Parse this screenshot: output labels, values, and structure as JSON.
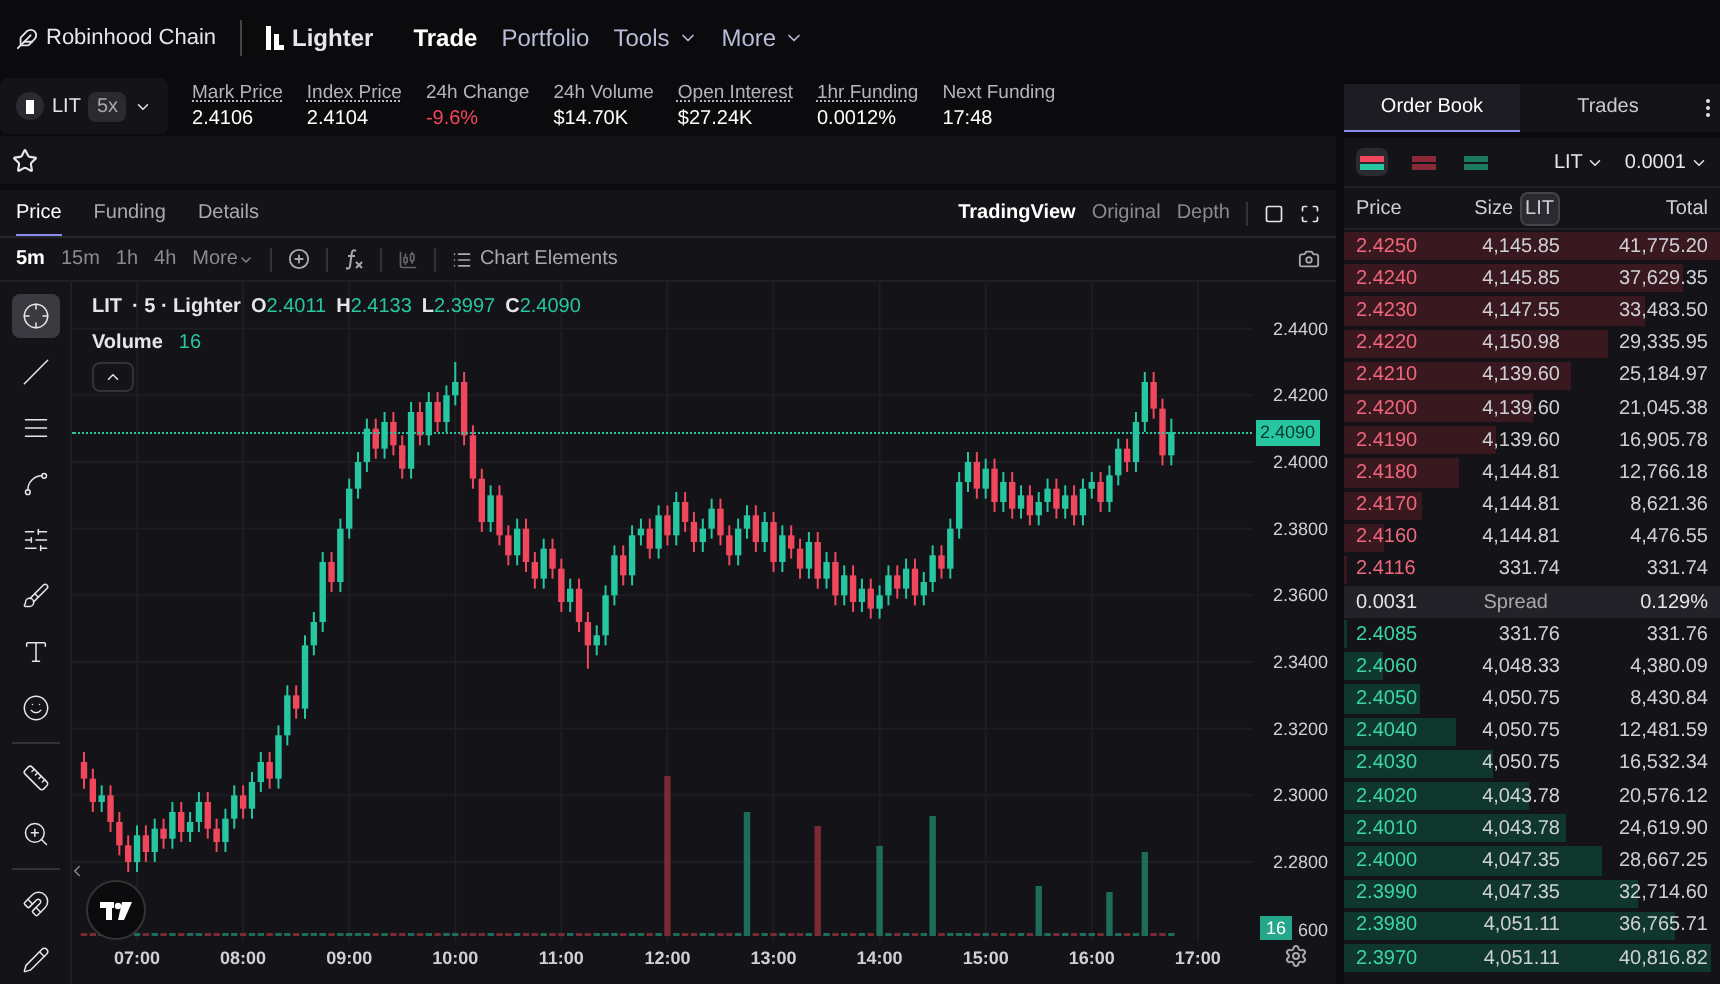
{
  "nav": {
    "brand": "Robinhood Chain",
    "logo": "Lighter",
    "items": [
      {
        "label": "Trade",
        "selected": true,
        "menu": false
      },
      {
        "label": "Portfolio",
        "selected": false,
        "menu": false
      },
      {
        "label": "Tools",
        "selected": false,
        "menu": true
      },
      {
        "label": "More",
        "selected": false,
        "menu": true
      }
    ]
  },
  "market": {
    "symbol": "LIT",
    "leverage": "5x",
    "stats": [
      {
        "label": "Mark Price",
        "value": "2.4106",
        "underlined": true,
        "negative": false
      },
      {
        "label": "Index Price",
        "value": "2.4104",
        "underlined": true,
        "negative": false
      },
      {
        "label": "24h Change",
        "value": "-9.6%",
        "underlined": false,
        "negative": true
      },
      {
        "label": "24h Volume",
        "value": "$14.70K",
        "underlined": false,
        "negative": false
      },
      {
        "label": "Open Interest",
        "value": "$27.24K",
        "underlined": true,
        "negative": false
      },
      {
        "label": "1hr Funding",
        "value": "0.0012%",
        "underlined": true,
        "negative": false
      },
      {
        "label": "Next Funding",
        "value": "17:48",
        "underlined": false,
        "negative": false
      }
    ]
  },
  "chart_tabs": [
    {
      "label": "Price",
      "selected": true
    },
    {
      "label": "Funding",
      "selected": false
    },
    {
      "label": "Details",
      "selected": false
    }
  ],
  "chart_views": [
    {
      "label": "TradingView",
      "selected": true
    },
    {
      "label": "Original",
      "selected": false
    },
    {
      "label": "Depth",
      "selected": false
    }
  ],
  "intervals": [
    {
      "label": "5m",
      "selected": true
    },
    {
      "label": "15m",
      "selected": false
    },
    {
      "label": "1h",
      "selected": false
    },
    {
      "label": "4h",
      "selected": false
    }
  ],
  "more_label": "More",
  "chart_elements": "Chart Elements",
  "legend": {
    "title": "LIT",
    "detail": "· 5 · Lighter",
    "ohlc": [
      {
        "key": "O",
        "value": "2.4011"
      },
      {
        "key": "H",
        "value": "2.4133"
      },
      {
        "key": "L",
        "value": "2.3997"
      },
      {
        "key": "C",
        "value": "2.4090"
      }
    ],
    "volume_label": "Volume",
    "volume_value": "16"
  },
  "chart": {
    "chart_data": {
      "type": "candlestick",
      "ylim": [
        2.256,
        2.454
      ],
      "categories": [
        null,
        null,
        null,
        null,
        null,
        null,
        "07:00",
        null,
        null,
        null,
        null,
        null,
        null,
        null,
        null,
        null,
        null,
        null,
        "08:00",
        null,
        null,
        null,
        null,
        null,
        null,
        null,
        null,
        null,
        null,
        null,
        "09:00",
        null,
        null,
        null,
        null,
        null,
        null,
        null,
        null,
        null,
        null,
        null,
        "10:00",
        null,
        null,
        null,
        null,
        null,
        null,
        null,
        null,
        null,
        null,
        null,
        "11:00",
        null,
        null,
        null,
        null,
        null,
        null,
        null,
        null,
        null,
        null,
        null,
        "12:00",
        null,
        null,
        null,
        null,
        null,
        null,
        null,
        null,
        null,
        null,
        null,
        "13:00",
        null,
        null,
        null,
        null,
        null,
        null,
        null,
        null,
        null,
        null,
        null,
        "14:00",
        null,
        null,
        null,
        null,
        null,
        null,
        null,
        null,
        null,
        null,
        null,
        "15:00",
        null,
        null,
        null,
        null,
        null,
        null,
        null,
        null,
        null,
        null,
        null,
        "16:00",
        null,
        null,
        null,
        null,
        null,
        null,
        null,
        null,
        null,
        null,
        null,
        "17:00"
      ],
      "ohlc": [
        [
          2.31,
          2.313,
          2.302,
          2.305
        ],
        [
          2.305,
          2.308,
          2.295,
          2.298
        ],
        [
          2.298,
          2.303,
          2.295,
          2.3
        ],
        [
          2.3,
          2.303,
          2.289,
          2.292
        ],
        [
          2.292,
          2.295,
          2.282,
          2.285
        ],
        [
          2.285,
          2.288,
          2.277,
          2.28
        ],
        [
          2.28,
          2.291,
          2.277,
          2.288
        ],
        [
          2.288,
          2.291,
          2.28,
          2.283
        ],
        [
          2.283,
          2.293,
          2.28,
          2.29
        ],
        [
          2.29,
          2.293,
          2.284,
          2.287
        ],
        [
          2.287,
          2.298,
          2.284,
          2.295
        ],
        [
          2.295,
          2.298,
          2.286,
          2.289
        ],
        [
          2.289,
          2.295,
          2.286,
          2.292
        ],
        [
          2.292,
          2.301,
          2.289,
          2.298
        ],
        [
          2.298,
          2.301,
          2.287,
          2.29
        ],
        [
          2.29,
          2.293,
          2.283,
          2.286
        ],
        [
          2.286,
          2.296,
          2.283,
          2.293
        ],
        [
          2.293,
          2.303,
          2.29,
          2.3
        ],
        [
          2.3,
          2.303,
          2.293,
          2.296
        ],
        [
          2.296,
          2.307,
          2.293,
          2.304
        ],
        [
          2.304,
          2.313,
          2.301,
          2.31
        ],
        [
          2.31,
          2.313,
          2.302,
          2.305
        ],
        [
          2.305,
          2.321,
          2.302,
          2.318
        ],
        [
          2.318,
          2.333,
          2.315,
          2.33
        ],
        [
          2.33,
          2.333,
          2.323,
          2.326
        ],
        [
          2.326,
          2.348,
          2.323,
          2.345
        ],
        [
          2.345,
          2.355,
          2.342,
          2.352
        ],
        [
          2.352,
          2.373,
          2.349,
          2.37
        ],
        [
          2.37,
          2.373,
          2.361,
          2.364
        ],
        [
          2.364,
          2.383,
          2.361,
          2.38
        ],
        [
          2.38,
          2.395,
          2.377,
          2.392
        ],
        [
          2.392,
          2.403,
          2.389,
          2.4
        ],
        [
          2.4,
          2.413,
          2.397,
          2.41
        ],
        [
          2.41,
          2.413,
          2.401,
          2.404
        ],
        [
          2.404,
          2.415,
          2.401,
          2.412
        ],
        [
          2.412,
          2.415,
          2.402,
          2.405
        ],
        [
          2.405,
          2.408,
          2.395,
          2.398
        ],
        [
          2.398,
          2.418,
          2.395,
          2.415
        ],
        [
          2.415,
          2.418,
          2.405,
          2.408
        ],
        [
          2.408,
          2.421,
          2.405,
          2.418
        ],
        [
          2.418,
          2.421,
          2.409,
          2.412
        ],
        [
          2.412,
          2.423,
          2.409,
          2.42
        ],
        [
          2.42,
          2.43,
          2.417,
          2.424
        ],
        [
          2.424,
          2.427,
          2.405,
          2.408
        ],
        [
          2.408,
          2.411,
          2.392,
          2.395
        ],
        [
          2.395,
          2.398,
          2.379,
          2.382
        ],
        [
          2.382,
          2.393,
          2.379,
          2.39
        ],
        [
          2.39,
          2.393,
          2.375,
          2.378
        ],
        [
          2.378,
          2.381,
          2.369,
          2.372
        ],
        [
          2.372,
          2.383,
          2.369,
          2.38
        ],
        [
          2.38,
          2.383,
          2.367,
          2.37
        ],
        [
          2.37,
          2.373,
          2.362,
          2.365
        ],
        [
          2.365,
          2.377,
          2.362,
          2.374
        ],
        [
          2.374,
          2.377,
          2.365,
          2.368
        ],
        [
          2.368,
          2.371,
          2.355,
          2.358
        ],
        [
          2.358,
          2.365,
          2.355,
          2.362
        ],
        [
          2.362,
          2.365,
          2.349,
          2.352
        ],
        [
          2.352,
          2.355,
          2.338,
          2.345
        ],
        [
          2.345,
          2.351,
          2.342,
          2.348
        ],
        [
          2.348,
          2.363,
          2.345,
          2.36
        ],
        [
          2.36,
          2.375,
          2.357,
          2.372
        ],
        [
          2.372,
          2.375,
          2.363,
          2.366
        ],
        [
          2.366,
          2.381,
          2.363,
          2.378
        ],
        [
          2.378,
          2.383,
          2.375,
          2.38
        ],
        [
          2.38,
          2.383,
          2.371,
          2.374
        ],
        [
          2.374,
          2.387,
          2.371,
          2.384
        ],
        [
          2.384,
          2.387,
          2.375,
          2.378
        ],
        [
          2.378,
          2.391,
          2.375,
          2.388
        ],
        [
          2.388,
          2.391,
          2.379,
          2.382
        ],
        [
          2.382,
          2.385,
          2.373,
          2.376
        ],
        [
          2.376,
          2.383,
          2.373,
          2.38
        ],
        [
          2.38,
          2.389,
          2.377,
          2.386
        ],
        [
          2.386,
          2.389,
          2.375,
          2.378
        ],
        [
          2.378,
          2.381,
          2.369,
          2.372
        ],
        [
          2.372,
          2.383,
          2.369,
          2.38
        ],
        [
          2.38,
          2.387,
          2.377,
          2.384
        ],
        [
          2.384,
          2.387,
          2.373,
          2.376
        ],
        [
          2.376,
          2.385,
          2.373,
          2.382
        ],
        [
          2.382,
          2.385,
          2.367,
          2.37
        ],
        [
          2.37,
          2.381,
          2.367,
          2.378
        ],
        [
          2.378,
          2.381,
          2.371,
          2.374
        ],
        [
          2.374,
          2.377,
          2.365,
          2.368
        ],
        [
          2.368,
          2.379,
          2.365,
          2.376
        ],
        [
          2.376,
          2.379,
          2.362,
          2.365
        ],
        [
          2.365,
          2.373,
          2.362,
          2.37
        ],
        [
          2.37,
          2.373,
          2.357,
          2.36
        ],
        [
          2.36,
          2.369,
          2.357,
          2.366
        ],
        [
          2.366,
          2.369,
          2.355,
          2.358
        ],
        [
          2.358,
          2.365,
          2.355,
          2.362
        ],
        [
          2.362,
          2.365,
          2.353,
          2.356
        ],
        [
          2.356,
          2.363,
          2.353,
          2.36
        ],
        [
          2.36,
          2.369,
          2.357,
          2.366
        ],
        [
          2.366,
          2.369,
          2.359,
          2.362
        ],
        [
          2.362,
          2.371,
          2.359,
          2.368
        ],
        [
          2.368,
          2.371,
          2.357,
          2.36
        ],
        [
          2.36,
          2.367,
          2.357,
          2.364
        ],
        [
          2.364,
          2.375,
          2.361,
          2.372
        ],
        [
          2.372,
          2.375,
          2.365,
          2.368
        ],
        [
          2.368,
          2.383,
          2.365,
          2.38
        ],
        [
          2.38,
          2.397,
          2.377,
          2.394
        ],
        [
          2.394,
          2.403,
          2.391,
          2.4
        ],
        [
          2.4,
          2.403,
          2.389,
          2.392
        ],
        [
          2.392,
          2.401,
          2.389,
          2.398
        ],
        [
          2.398,
          2.401,
          2.385,
          2.388
        ],
        [
          2.388,
          2.397,
          2.385,
          2.394
        ],
        [
          2.394,
          2.397,
          2.383,
          2.386
        ],
        [
          2.386,
          2.393,
          2.383,
          2.39
        ],
        [
          2.39,
          2.393,
          2.381,
          2.384
        ],
        [
          2.384,
          2.391,
          2.381,
          2.388
        ],
        [
          2.388,
          2.395,
          2.385,
          2.392
        ],
        [
          2.392,
          2.395,
          2.383,
          2.386
        ],
        [
          2.386,
          2.393,
          2.383,
          2.39
        ],
        [
          2.39,
          2.393,
          2.381,
          2.384
        ],
        [
          2.384,
          2.395,
          2.381,
          2.392
        ],
        [
          2.392,
          2.397,
          2.389,
          2.394
        ],
        [
          2.394,
          2.397,
          2.385,
          2.388
        ],
        [
          2.388,
          2.399,
          2.385,
          2.396
        ],
        [
          2.396,
          2.407,
          2.393,
          2.404
        ],
        [
          2.404,
          2.407,
          2.397,
          2.4
        ],
        [
          2.4,
          2.415,
          2.397,
          2.412
        ],
        [
          2.412,
          2.427,
          2.409,
          2.424
        ],
        [
          2.424,
          2.427,
          2.413,
          2.416
        ],
        [
          2.416,
          2.419,
          2.399,
          2.402
        ],
        [
          2.402,
          2.413,
          2.399,
          2.409
        ],
        null,
        null,
        null
      ],
      "yticks": [
        {
          "value": 2.44,
          "label": "2.4400"
        },
        {
          "value": 2.42,
          "label": "2.4200"
        },
        {
          "value": 2.4,
          "label": "2.4000"
        },
        {
          "value": 2.38,
          "label": "2.3800"
        },
        {
          "value": 2.36,
          "label": "2.3600"
        },
        {
          "value": 2.34,
          "label": "2.3400"
        },
        {
          "value": 2.32,
          "label": "2.3200"
        },
        {
          "value": 2.3,
          "label": "2.3000"
        },
        {
          "value": 2.28,
          "label": "2.2800"
        }
      ],
      "grid": true
    },
    "partial_tick": "600",
    "last_price": "2.4090",
    "volume_tag": "16"
  },
  "tools": [
    {
      "kind": "crosshair",
      "selected": true
    },
    {
      "kind": "line",
      "selected": false
    },
    {
      "kind": "hlines",
      "selected": false
    },
    {
      "kind": "pattern",
      "selected": false
    },
    {
      "kind": "fib",
      "selected": false
    },
    {
      "kind": "brush",
      "selected": false
    },
    {
      "kind": "text",
      "selected": false
    },
    {
      "kind": "emoji",
      "selected": false
    },
    {
      "kind": "ruler",
      "selected": false
    },
    {
      "kind": "zoom",
      "selected": false
    },
    {
      "kind": "magnet",
      "selected": false
    },
    {
      "kind": "pencil",
      "selected": false
    }
  ],
  "book": {
    "tabs": [
      {
        "label": "Order Book",
        "selected": true
      },
      {
        "label": "Trades",
        "selected": false
      }
    ],
    "modes": [
      {
        "kind": "both",
        "selected": true
      },
      {
        "kind": "asks",
        "selected": false
      },
      {
        "kind": "bids",
        "selected": false
      }
    ],
    "asset": "LIT",
    "step": "0.0001",
    "columns": {
      "price": "Price",
      "size": "Size",
      "unit": "LIT",
      "total": "Total"
    },
    "asks": [
      {
        "price": "2.4250",
        "size": "4,145.85",
        "total": "41,775.20"
      },
      {
        "price": "2.4240",
        "size": "4,145.85",
        "total": "37,629.35"
      },
      {
        "price": "2.4230",
        "size": "4,147.55",
        "total": "33,483.50"
      },
      {
        "price": "2.4220",
        "size": "4,150.98",
        "total": "29,335.95"
      },
      {
        "price": "2.4210",
        "size": "4,139.60",
        "total": "25,184.97"
      },
      {
        "price": "2.4200",
        "size": "4,139.60",
        "total": "21,045.38"
      },
      {
        "price": "2.4190",
        "size": "4,139.60",
        "total": "16,905.78"
      },
      {
        "price": "2.4180",
        "size": "4,144.81",
        "total": "12,766.18"
      },
      {
        "price": "2.4170",
        "size": "4,144.81",
        "total": "8,621.36"
      },
      {
        "price": "2.4160",
        "size": "4,144.81",
        "total": "4,476.55"
      },
      {
        "price": "2.4116",
        "size": "331.74",
        "total": "331.74"
      }
    ],
    "spread": {
      "value": "0.0031",
      "label": "Spread",
      "percent": "0.129%"
    },
    "bids": [
      {
        "price": "2.4085",
        "size": "331.76",
        "total": "331.76"
      },
      {
        "price": "2.4060",
        "size": "4,048.33",
        "total": "4,380.09"
      },
      {
        "price": "2.4050",
        "size": "4,050.75",
        "total": "8,430.84"
      },
      {
        "price": "2.4040",
        "size": "4,050.75",
        "total": "12,481.59"
      },
      {
        "price": "2.4030",
        "size": "4,050.75",
        "total": "16,532.34"
      },
      {
        "price": "2.4020",
        "size": "4,043.78",
        "total": "20,576.12"
      },
      {
        "price": "2.4010",
        "size": "4,043.78",
        "total": "24,619.90"
      },
      {
        "price": "2.4000",
        "size": "4,047.35",
        "total": "28,667.25"
      },
      {
        "price": "2.3990",
        "size": "4,047.35",
        "total": "32,714.60"
      },
      {
        "price": "2.3980",
        "size": "4,051.11",
        "total": "36,765.71"
      },
      {
        "price": "2.3970",
        "size": "4,051.11",
        "total": "40,816.82"
      }
    ]
  }
}
